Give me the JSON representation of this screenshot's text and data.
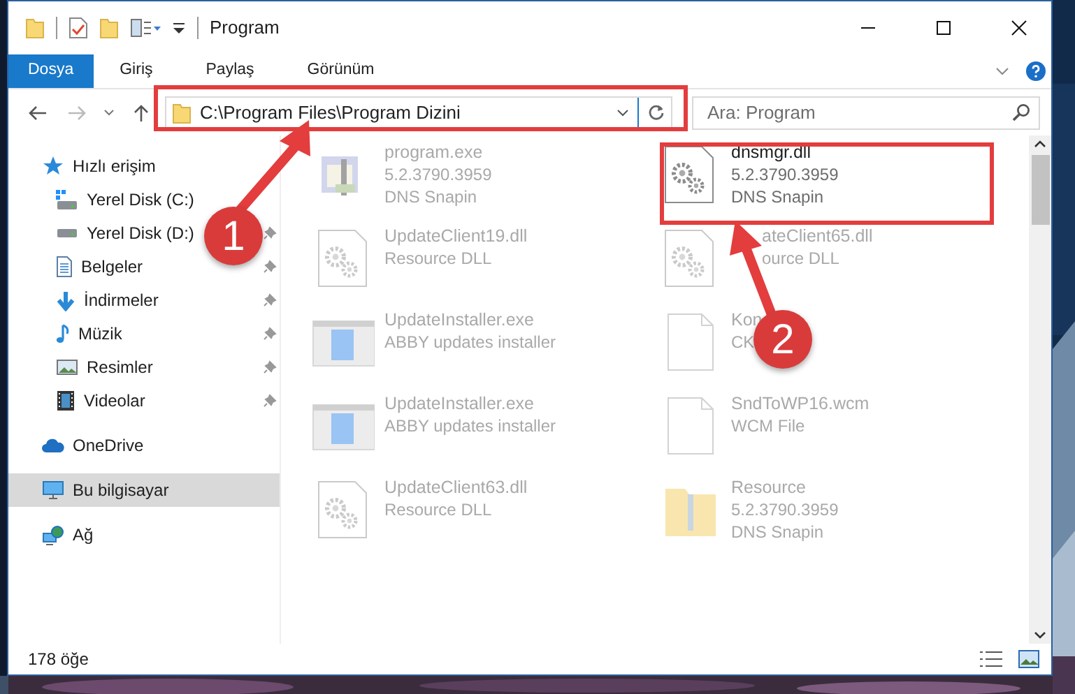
{
  "window": {
    "title": "Program"
  },
  "ribbon_tabs": [
    {
      "label": "Dosya",
      "kind": "file"
    },
    {
      "label": "Giriş",
      "kind": "tab"
    },
    {
      "label": "Paylaş",
      "kind": "tab"
    },
    {
      "label": "Görünüm",
      "kind": "tab"
    }
  ],
  "address_bar": {
    "path": "C:\\Program Files\\Program Dizini"
  },
  "search": {
    "placeholder": "Ara: Program"
  },
  "navigation": [
    {
      "label": "Hızlı erişim",
      "kind": "star",
      "selected": false,
      "children": [
        {
          "label": "Yerel Disk (C:)",
          "kind": "system-drive",
          "pinned": false,
          "selected": false
        },
        {
          "label": "Yerel Disk (D:)",
          "kind": "drive",
          "pinned": true,
          "selected": false
        },
        {
          "label": "Belgeler",
          "kind": "documents",
          "pinned": true,
          "selected": false
        },
        {
          "label": "İndirmeler",
          "kind": "downloads",
          "pinned": true,
          "selected": false
        },
        {
          "label": "Müzik",
          "kind": "music",
          "pinned": true,
          "selected": false
        },
        {
          "label": "Resimler",
          "kind": "pictures",
          "pinned": true,
          "selected": false
        },
        {
          "label": "Videolar",
          "kind": "videos",
          "pinned": true,
          "selected": false
        }
      ]
    },
    {
      "label": "OneDrive",
      "kind": "cloud",
      "selected": false
    },
    {
      "label": "Bu bilgisayar",
      "kind": "computer",
      "selected": true
    },
    {
      "label": "Ağ",
      "kind": "network",
      "selected": false
    }
  ],
  "files": [
    {
      "name": "program.exe",
      "details": [
        "5.2.3790.3959",
        "DNS Snapin"
      ],
      "kind": "app",
      "blurred": true
    },
    {
      "name": "dnsmgr.dll",
      "details": [
        "5.2.3790.3959",
        "DNS Snapin"
      ],
      "kind": "dll",
      "blurred": false
    },
    {
      "name": "UpdateClient19.dll",
      "details": [
        "Resource DLL"
      ],
      "kind": "dll",
      "blurred": true
    },
    {
      "name": "ateClient65.dll",
      "details": [
        "ource DLL"
      ],
      "kind": "dll",
      "blurred": true,
      "partly_covered": true
    },
    {
      "name": "UpdateInstaller.exe",
      "details": [
        "ABBY updates installer"
      ],
      "kind": "installer",
      "blurred": true
    },
    {
      "name": "Kon",
      "details": [
        "CK"
      ],
      "kind": "document",
      "blurred": true
    },
    {
      "name": "UpdateInstaller.exe",
      "details": [
        "ABBY updates installer"
      ],
      "kind": "installer",
      "blurred": true
    },
    {
      "name": "SndToWP16.wcm",
      "details": [
        "WCM File"
      ],
      "kind": "document",
      "blurred": true
    },
    {
      "name": "UpdateClient63.dll",
      "details": [
        "Resource DLL"
      ],
      "kind": "dll",
      "blurred": true
    },
    {
      "name": "Resource",
      "details": [
        "5.2.3790.3959",
        "DNS Snapin"
      ],
      "kind": "folder",
      "blurred": true
    }
  ],
  "status_bar": {
    "item_count": "178 öğe"
  },
  "annotations": [
    {
      "label": "1"
    },
    {
      "label": "2"
    }
  ]
}
